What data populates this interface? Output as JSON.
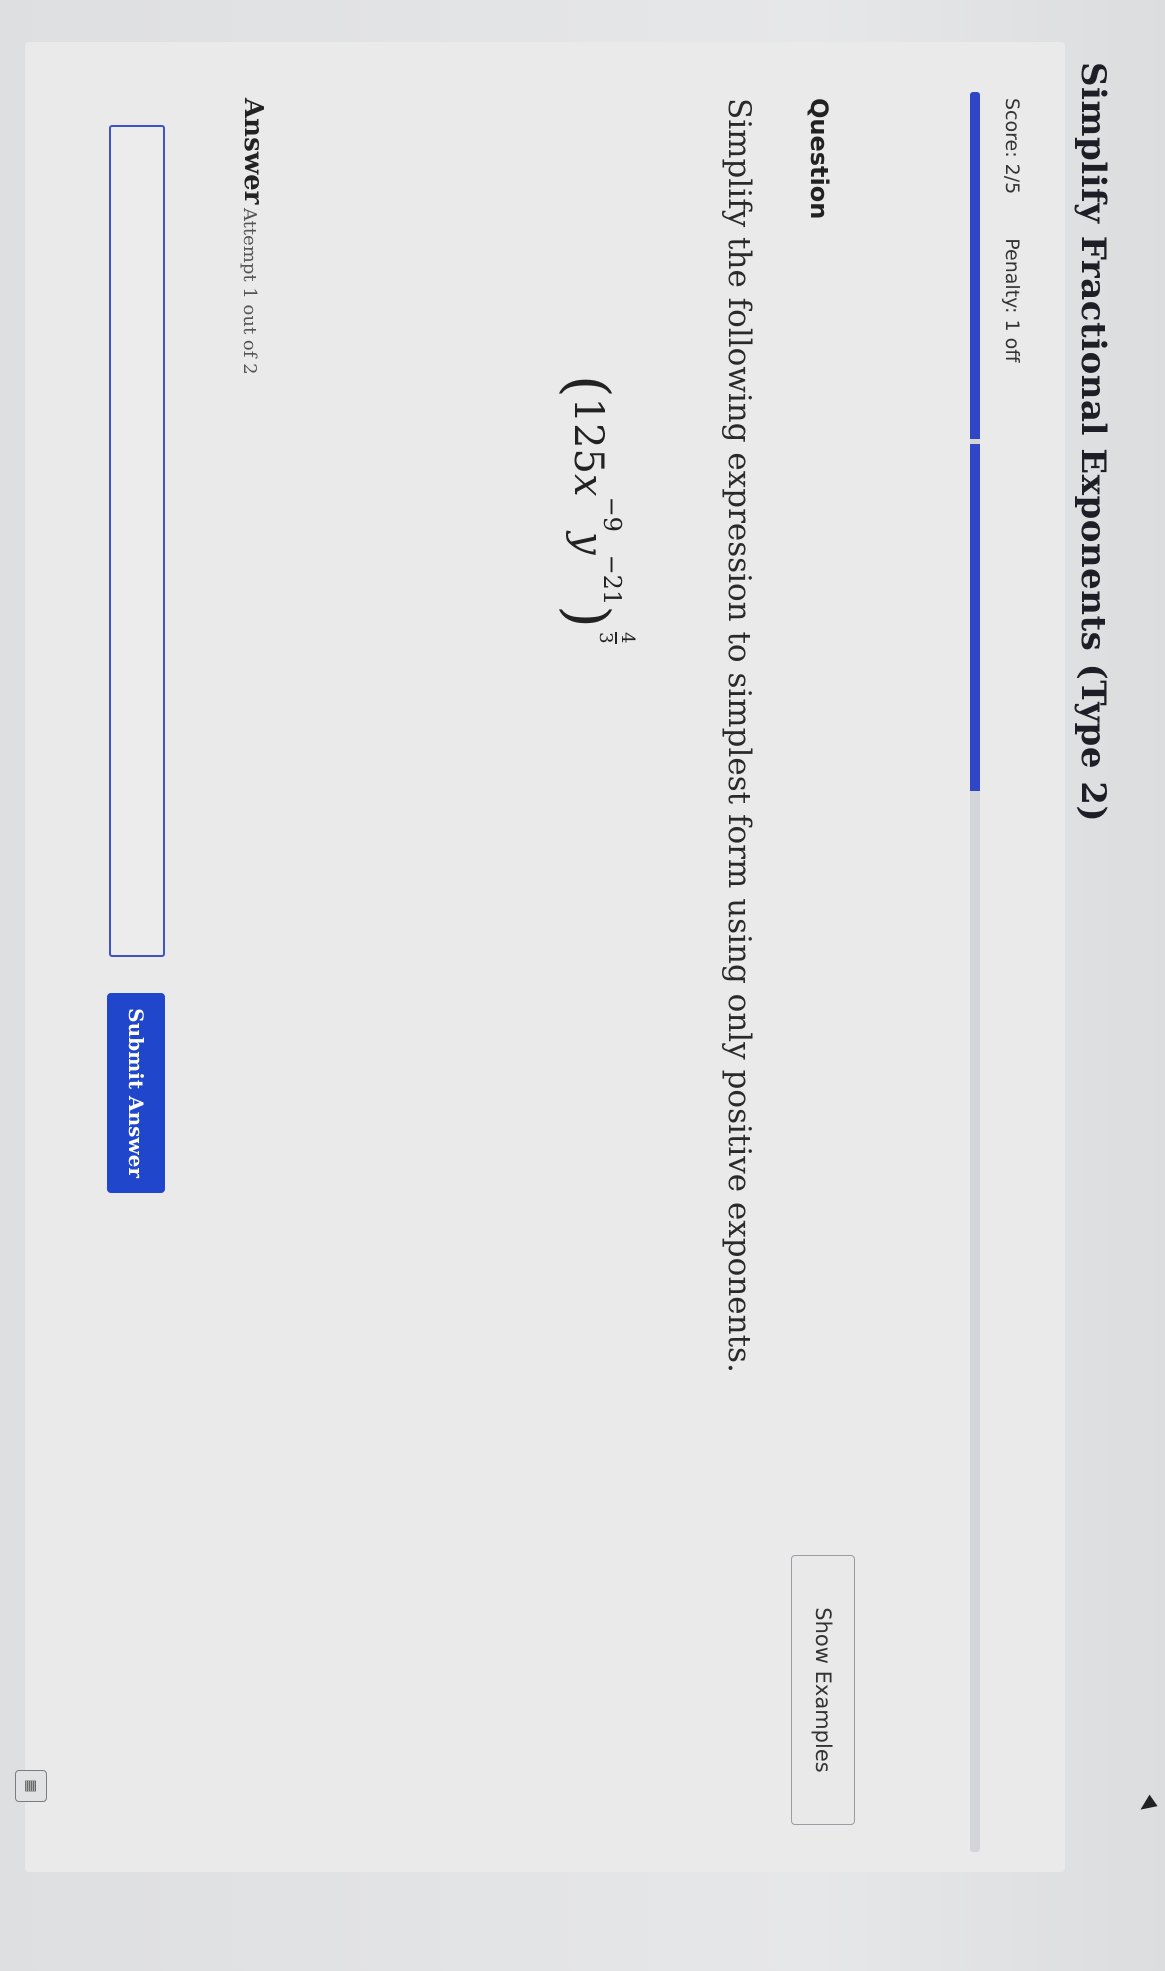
{
  "page": {
    "title": "Simplify Fractional Exponents (Type 2)"
  },
  "status": {
    "score": "Score: 2/5",
    "penalty": "Penalty: 1 off"
  },
  "progress": {
    "filled_segments": 2,
    "total_segments": 5,
    "fill_color": "#2f46c7"
  },
  "question": {
    "label": "Question",
    "show_examples_label": "Show Examples",
    "prompt": "Simplify the following expression to simplest form using only positive exponents.",
    "expression": {
      "coefficient": "125",
      "var1": "x",
      "exp1": "−9",
      "var2": "y",
      "exp2": "−21",
      "outer_exp_num": "4",
      "outer_exp_den": "3"
    }
  },
  "answer": {
    "label": "Answer",
    "attempt_text": "Attempt 1 out of 2",
    "input_value": "",
    "submit_label": "Submit Answer"
  },
  "icons": {
    "calculator": "calculator-icon",
    "cursor": "cursor-arrow-icon"
  },
  "colors": {
    "accent": "#2046cc",
    "input_border": "#3e53c4"
  }
}
